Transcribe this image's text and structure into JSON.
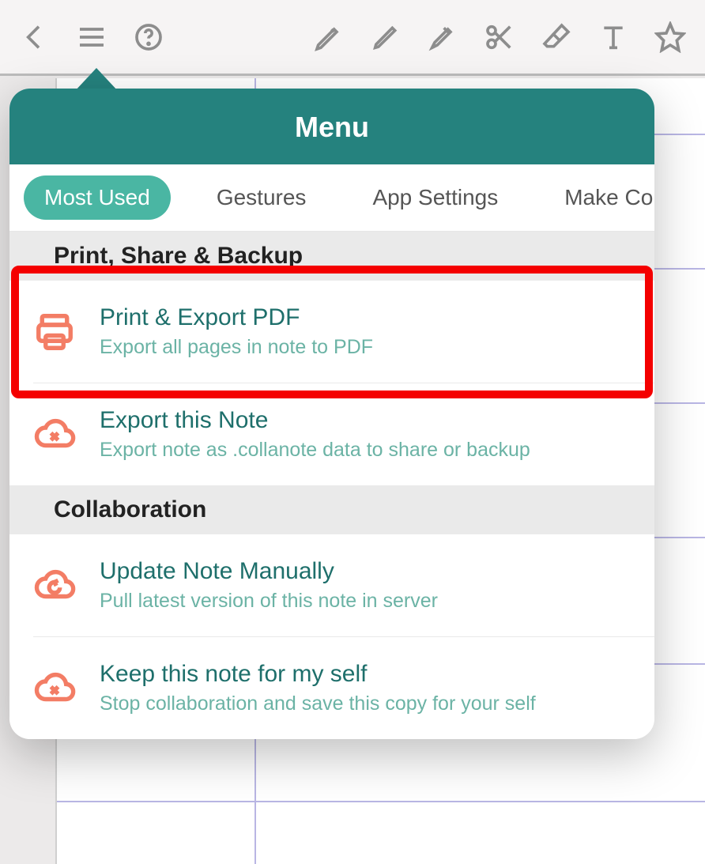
{
  "popover": {
    "title": "Menu",
    "tabs": [
      "Most Used",
      "Gestures",
      "App Settings",
      "Make Colla"
    ],
    "activeTab": 0,
    "sections": [
      {
        "header": "Print, Share & Backup",
        "items": [
          {
            "title": "Print & Export PDF",
            "sub": "Export all pages in note to PDF",
            "icon": "printer"
          },
          {
            "title": "Export this Note",
            "sub": "Export note as .collanote data to share or backup",
            "icon": "cloud-x"
          }
        ]
      },
      {
        "header": "Collaboration",
        "items": [
          {
            "title": "Update Note Manually",
            "sub": "Pull latest version of this note in server",
            "icon": "cloud-refresh"
          },
          {
            "title": "Keep this note for my self",
            "sub": "Stop collaboration and save this copy for your self",
            "icon": "cloud-x"
          }
        ]
      }
    ]
  }
}
